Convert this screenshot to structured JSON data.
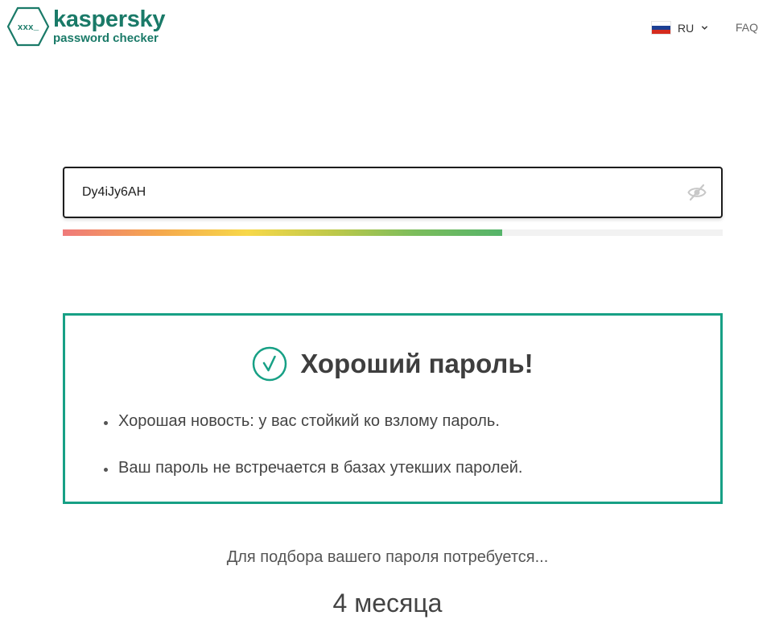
{
  "header": {
    "logo": {
      "brand": "kaspersky",
      "subtitle": "password checker",
      "hex_text": "xxx_"
    },
    "language": {
      "code": "RU",
      "flag_colors": [
        "#ffffff",
        "#1c3f94",
        "#d52b1e"
      ]
    },
    "faq_label": "FAQ"
  },
  "password": {
    "value": "Dy4iJy6AH",
    "visibility_icon": "eye-slash-icon"
  },
  "strength": {
    "level_fraction": 0.666
  },
  "result": {
    "icon": "checkmark-circle-icon",
    "title": "Хороший пароль!",
    "bullets": [
      "Хорошая новость: у вас стойкий ко взлому пароль.",
      "Ваш пароль не встречается в базах утекших паролей."
    ]
  },
  "crack_time": {
    "label": "Для подбора вашего пароля потребуется...",
    "value": "4 месяца"
  },
  "colors": {
    "brand": "#1a7a68",
    "accent": "#17a085",
    "strength_gradient": [
      "#ef7a7a",
      "#f5a84d",
      "#f7d84a",
      "#bcc84a",
      "#55b46a"
    ]
  }
}
